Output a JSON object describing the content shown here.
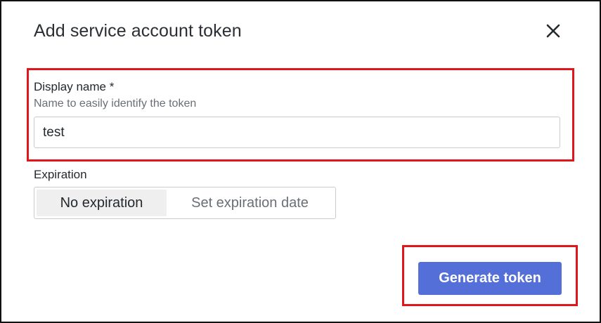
{
  "dialog": {
    "title": "Add service account token",
    "close_icon": "close-icon"
  },
  "display_name": {
    "label": "Display name *",
    "description": "Name to easily identify the token",
    "value": "test"
  },
  "expiration": {
    "label": "Expiration",
    "options": [
      "No expiration",
      "Set expiration date"
    ],
    "selected": "No expiration"
  },
  "actions": {
    "generate_label": "Generate token"
  },
  "colors": {
    "accent": "#5470d8",
    "highlight": "#e0161b"
  }
}
